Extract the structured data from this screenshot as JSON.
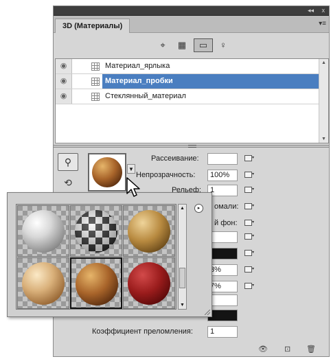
{
  "panel": {
    "collapse_label": "◂◂",
    "close_label": "x",
    "tab_title": "3D (Материалы)",
    "tab_menu_label": "▾≡"
  },
  "toolbar": {
    "buttons": [
      {
        "name": "scene-filter-icon",
        "glyph": "⌖"
      },
      {
        "name": "mesh-filter-icon",
        "glyph": "▦"
      },
      {
        "name": "materials-filter-icon",
        "glyph": "▭"
      },
      {
        "name": "lights-filter-icon",
        "glyph": "♀"
      }
    ]
  },
  "materials": [
    {
      "label": "Материал_ярлыка",
      "selected": false
    },
    {
      "label": "Материал_пробки",
      "selected": true
    },
    {
      "label": "Стеклянный_материал",
      "selected": false
    }
  ],
  "properties": {
    "diffuse_label": "Рассеивание:",
    "opacity_label": "Непрозрачность:",
    "opacity_value": "100%",
    "bump_label": "Рельеф:",
    "bump_value": "1",
    "normal_label_partial": "омали:",
    "env_label_partial": "й фон:",
    "value_a_partial": "3%",
    "value_b_partial": "7%",
    "refraction_label": "Коэффициент преломления:",
    "refraction_value": "1"
  },
  "popup": {
    "preset_count": 6,
    "selected_index": 4,
    "menu_glyph": "▸"
  },
  "bottom": {
    "toggle_icon": "👁",
    "new_icon": "⊡",
    "delete_icon": "🗑"
  }
}
